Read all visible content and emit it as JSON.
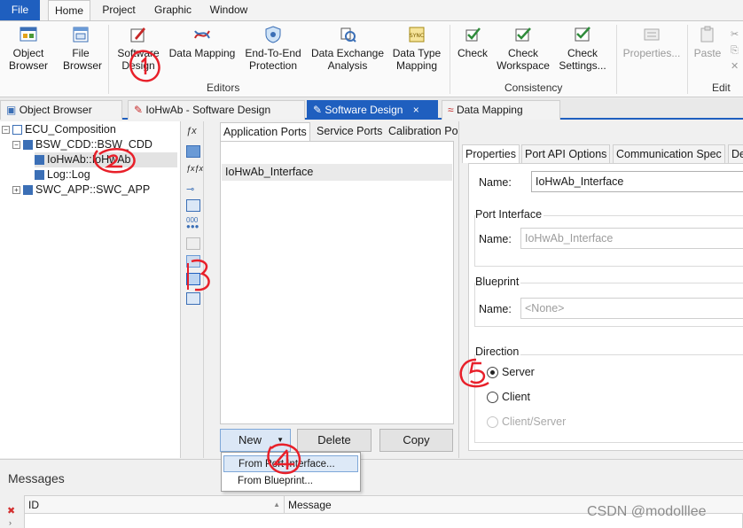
{
  "ribbon_tabs": [
    "File",
    "Home",
    "Project",
    "Graphic",
    "Window"
  ],
  "ribbon": {
    "object_browser": "Object Browser",
    "file_browser": "File Browser",
    "software_design": "Software Design",
    "data_mapping": "Data Mapping",
    "end_to_end": "End-To-End Protection",
    "data_exchange": "Data Exchange Analysis",
    "data_type_mapping": "Data Type Mapping",
    "check": "Check",
    "check_workspace": "Check Workspace",
    "check_settings": "Check Settings...",
    "properties": "Properties...",
    "paste": "Paste",
    "group_editors": "Editors",
    "group_consistency": "Consistency",
    "group_edit": "Edit"
  },
  "doc_tabs": {
    "object_browser": "Object Browser",
    "iohwab_sd": "IoHwAb - Software Design",
    "software_design": "Software Design",
    "close": "×",
    "data_mapping": "Data Mapping"
  },
  "tree": {
    "root": "ECU_Composition",
    "bsw_cdd": "BSW_CDD::BSW_CDD",
    "iohwab": "IoHwAb::IoHwAb",
    "log": "Log::Log",
    "swc_app": "SWC_APP::SWC_APP"
  },
  "port_tabs": [
    "Application Ports",
    "Service Ports",
    "Calibration Ports"
  ],
  "port_list": {
    "items": [
      "IoHwAb_Interface"
    ]
  },
  "buttons": {
    "new": "New",
    "delete": "Delete",
    "copy": "Copy"
  },
  "dropdown": {
    "items": [
      "From Port Interface...",
      "From Blueprint..."
    ]
  },
  "prop_tabs": [
    "Properties",
    "Port API Options",
    "Communication Spec",
    "De"
  ],
  "properties": {
    "name_label": "Name:",
    "name_value": "IoHwAb_Interface",
    "port_interface_title": "Port Interface",
    "port_interface_value": "IoHwAb_Interface",
    "blueprint_title": "Blueprint",
    "blueprint_value": "<None>",
    "direction_title": "Direction",
    "direction_options": [
      "Server",
      "Client",
      "Client/Server"
    ],
    "direction_selected": "Server"
  },
  "messages": {
    "title": "Messages",
    "columns": [
      "ID",
      "Message"
    ]
  },
  "annotations": [
    "1",
    "2",
    "3",
    "4",
    "5"
  ],
  "watermark": "CSDN @modolllee",
  "colors": {
    "accent": "#1f5fbf",
    "annotation": "#e8202a"
  }
}
